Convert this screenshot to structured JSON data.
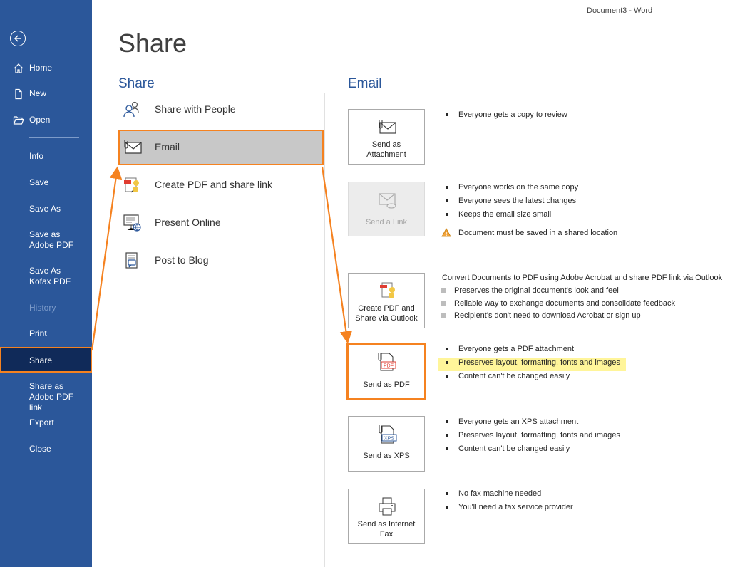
{
  "window": {
    "title": "Document3  -  Word"
  },
  "nav": {
    "home": "Home",
    "new": "New",
    "open": "Open",
    "info": "Info",
    "save": "Save",
    "save_as": "Save As",
    "save_adobe": "Save as Adobe PDF",
    "save_kofax": "Save As Kofax PDF",
    "history": "History",
    "print": "Print",
    "share": "Share",
    "share_adobe_link": "Share as Adobe PDF link",
    "export": "Export",
    "close": "Close"
  },
  "page": {
    "title": "Share",
    "share_heading": "Share",
    "email_heading": "Email"
  },
  "share_items": {
    "people": "Share with People",
    "email": "Email",
    "pdf_link": "Create PDF and share link",
    "present": "Present Online",
    "blog": "Post to Blog"
  },
  "email": {
    "attachment": {
      "label": "Send as Attachment",
      "bullets": [
        "Everyone gets a copy to review"
      ]
    },
    "link": {
      "label": "Send a Link",
      "bullets": [
        "Everyone works on the same copy",
        "Everyone sees the latest changes",
        "Keeps the email size small"
      ],
      "warning": "Document must be saved in a shared location"
    },
    "outlook": {
      "label": "Create PDF and Share via Outlook",
      "intro": "Convert Documents to PDF using Adobe Acrobat and share PDF link via Outlook",
      "bullets": [
        "Preserves the original document's look and feel",
        "Reliable way to exchange documents and consolidate feedback",
        "Recipient's don't need to download Acrobat or sign up"
      ]
    },
    "pdf": {
      "label": "Send as PDF",
      "bullets": [
        "Everyone gets a PDF attachment",
        "Preserves layout, formatting, fonts and images",
        "Content can't be changed easily"
      ]
    },
    "xps": {
      "label": "Send as XPS",
      "bullets": [
        "Everyone gets an XPS attachment",
        "Preserves layout, formatting, fonts and images",
        "Content can't be changed easily"
      ]
    },
    "fax": {
      "label": "Send as Internet Fax",
      "bullets": [
        "No fax machine needed",
        "You'll need a fax service provider"
      ]
    }
  },
  "icons": {
    "pdf_tag": "PDF",
    "xps_tag": "XPS"
  },
  "colors": {
    "nav_bg": "#2b579a",
    "accent": "#f58220",
    "highlight": "#fff59a"
  }
}
